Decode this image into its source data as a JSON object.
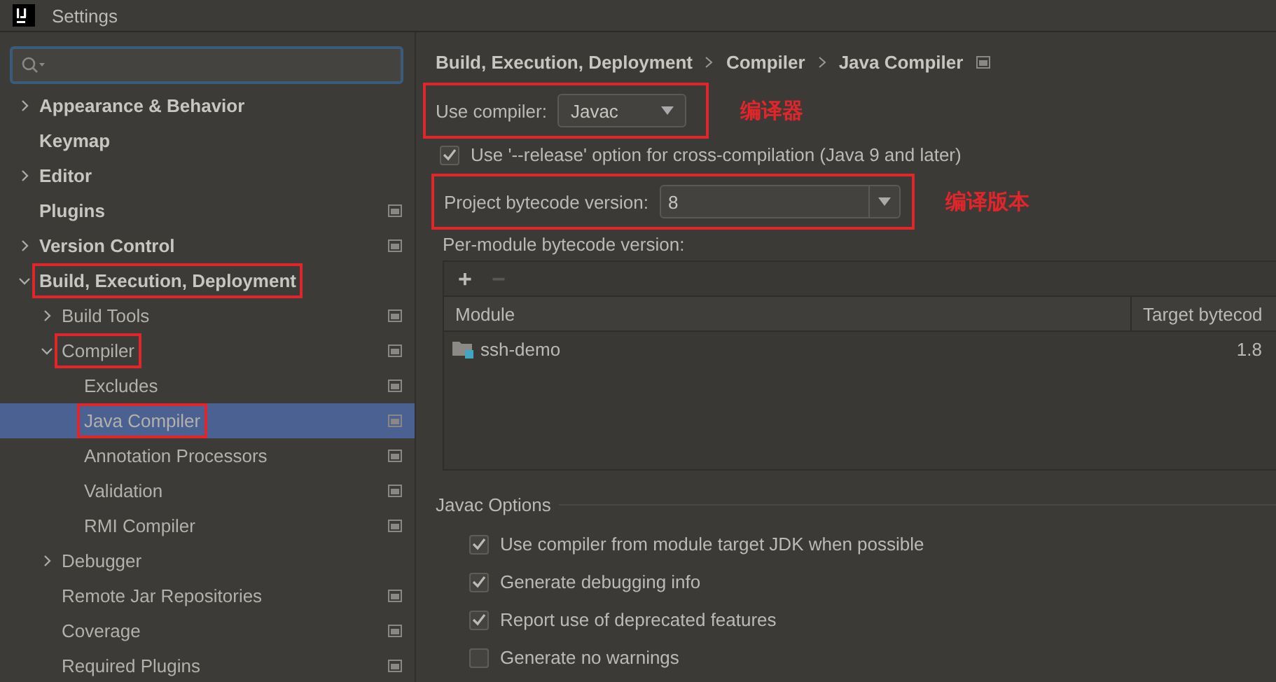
{
  "window": {
    "title": "Settings"
  },
  "tree": [
    {
      "label": "Appearance & Behavior",
      "expanded": false,
      "selected": false,
      "annotated": false,
      "project_level": false
    },
    {
      "label": "Keymap",
      "selected": false,
      "annotated": false,
      "project_level": false
    },
    {
      "label": "Editor",
      "expanded": false,
      "selected": false,
      "annotated": false,
      "project_level": false
    },
    {
      "label": "Plugins",
      "selected": false,
      "annotated": false,
      "project_level": true
    },
    {
      "label": "Version Control",
      "expanded": false,
      "selected": false,
      "annotated": false,
      "project_level": true
    },
    {
      "label": "Build, Execution, Deployment",
      "expanded": true,
      "selected": false,
      "annotated": true,
      "project_level": false,
      "children": [
        {
          "label": "Build Tools",
          "expanded": false,
          "selected": false,
          "annotated": false,
          "project_level": true
        },
        {
          "label": "Compiler",
          "expanded": true,
          "selected": false,
          "annotated": true,
          "project_level": true,
          "children": [
            {
              "label": "Excludes",
              "selected": false,
              "annotated": false,
              "project_level": true
            },
            {
              "label": "Java Compiler",
              "selected": true,
              "annotated": true,
              "project_level": true
            },
            {
              "label": "Annotation Processors",
              "selected": false,
              "annotated": false,
              "project_level": true
            },
            {
              "label": "Validation",
              "selected": false,
              "annotated": false,
              "project_level": true
            },
            {
              "label": "RMI Compiler",
              "selected": false,
              "annotated": false,
              "project_level": true
            }
          ]
        },
        {
          "label": "Debugger",
          "expanded": false,
          "selected": false,
          "annotated": false,
          "project_level": false
        },
        {
          "label": "Remote Jar Repositories",
          "selected": false,
          "annotated": false,
          "project_level": true
        },
        {
          "label": "Coverage",
          "selected": false,
          "annotated": false,
          "project_level": true
        },
        {
          "label": "Required Plugins",
          "selected": false,
          "annotated": false,
          "project_level": true
        }
      ]
    }
  ],
  "breadcrumb": [
    "Build, Execution, Deployment",
    "Compiler",
    "Java Compiler"
  ],
  "use_compiler": {
    "label": "Use compiler:",
    "value": "Javac",
    "annotated": true,
    "note": "编译器"
  },
  "release_option": {
    "label": "Use '--release' option for cross-compilation (Java 9 and later)",
    "checked": true
  },
  "bytecode_version": {
    "label": "Project bytecode version:",
    "value": "8",
    "annotated": true,
    "note": "编译版本"
  },
  "per_module": {
    "label": "Per-module bytecode version:",
    "add": "+",
    "remove": "−",
    "remove_disabled": true,
    "columns": [
      "Module",
      "Target bytecod"
    ],
    "rows": [
      {
        "module": "ssh-demo",
        "target": "1.8"
      }
    ]
  },
  "javac_options": {
    "title": "Javac Options",
    "options": [
      {
        "label": "Use compiler from module target JDK when possible",
        "checked": true
      },
      {
        "label": "Generate debugging info",
        "checked": true
      },
      {
        "label": "Report use of deprecated features",
        "checked": true
      },
      {
        "label": "Generate no warnings",
        "checked": false
      }
    ]
  }
}
